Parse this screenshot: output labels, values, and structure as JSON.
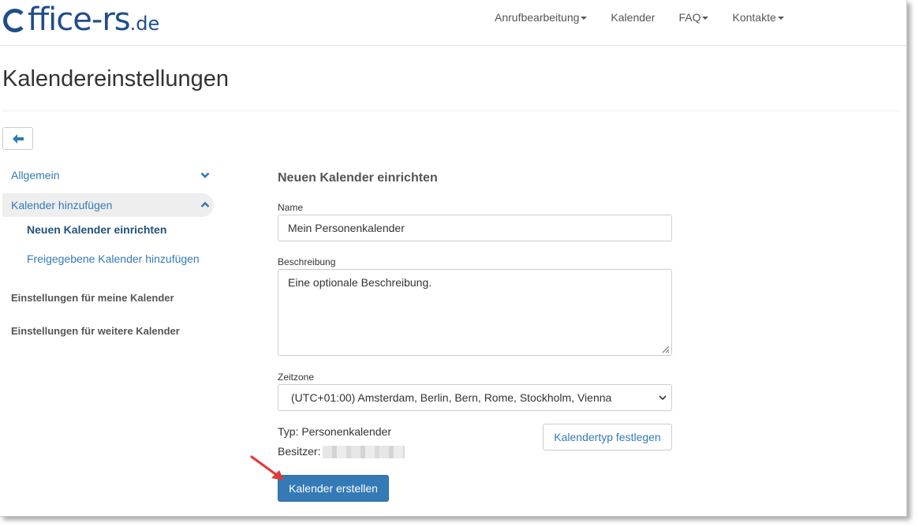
{
  "brand": {
    "logo_text": "ffice-rs",
    "logo_tld": ".de"
  },
  "nav": {
    "items": [
      {
        "label": "Anrufbearbeitung",
        "dropdown": true
      },
      {
        "label": "Kalender",
        "dropdown": false
      },
      {
        "label": "FAQ",
        "dropdown": true
      },
      {
        "label": "Kontakte",
        "dropdown": true
      }
    ]
  },
  "page": {
    "title": "Kalendereinstellungen"
  },
  "sidebar": {
    "general": "Allgemein",
    "add_calendar": "Kalender hinzufügen",
    "sub_new": "Neuen Kalender einrichten",
    "sub_shared": "Freigegebene Kalender hinzufügen",
    "my_calendars": "Einstellungen für meine Kalender",
    "other_calendars": "Einstellungen für weitere Kalender"
  },
  "form": {
    "heading": "Neuen Kalender einrichten",
    "name_label": "Name",
    "name_value": "Mein Personenkalender",
    "description_label": "Beschreibung",
    "description_value": "Eine optionale Beschreibung.",
    "timezone_label": "Zeitzone",
    "timezone_value": "(UTC+01:00) Amsterdam, Berlin, Bern, Rome, Stockholm, Vienna",
    "type_text": "Typ: Personenkalender",
    "owner_label": "Besitzer:",
    "set_type_button": "Kalendertyp festlegen",
    "create_button": "Kalender erstellen"
  },
  "colors": {
    "link": "#337ab7",
    "primary": "#337ab7",
    "logo": "#1f4d8c",
    "annotation_arrow": "#e03a3a"
  }
}
